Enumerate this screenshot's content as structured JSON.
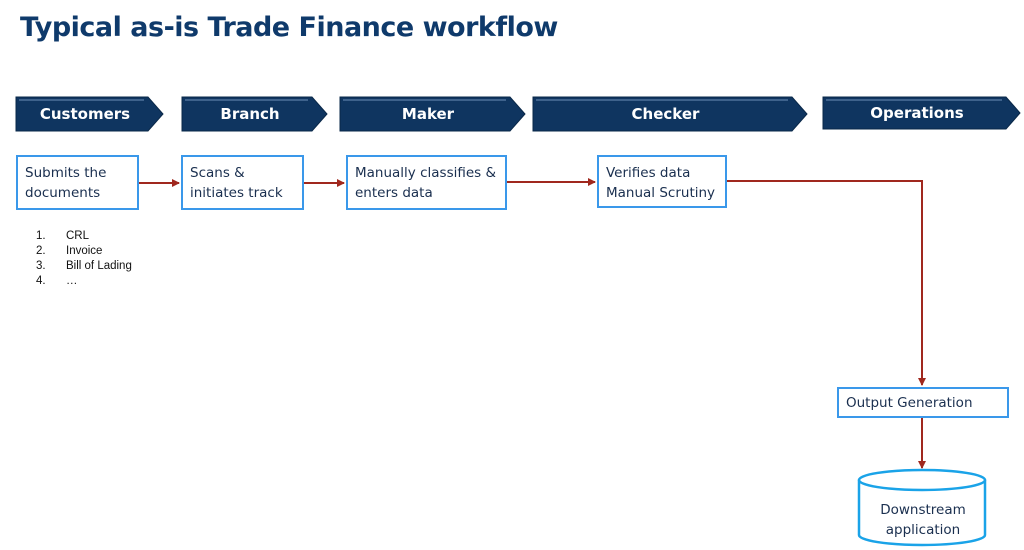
{
  "title": "Typical as-is Trade Finance workflow",
  "lanes": [
    {
      "label": "Customers"
    },
    {
      "label": "Branch"
    },
    {
      "label": "Maker"
    },
    {
      "label": "Checker"
    },
    {
      "label": "Operations"
    }
  ],
  "steps": {
    "customers": {
      "line1": "Submits the",
      "line2": "documents"
    },
    "branch": {
      "line1": "Scans &",
      "line2": "initiates track"
    },
    "maker": {
      "line1": "Manually classifies &",
      "line2": "enters data"
    },
    "checker": {
      "line1": "Verifies data",
      "line2": "Manual Scrutiny"
    },
    "operations": {
      "line1": "Output Generation"
    }
  },
  "documents": [
    {
      "num": "1.",
      "label": "CRL"
    },
    {
      "num": "2.",
      "label": "Invoice"
    },
    {
      "num": "3.",
      "label": "Bill of Lading"
    },
    {
      "num": "4.",
      "label": "…"
    }
  ],
  "downstream": {
    "line1": "Downstream",
    "line2": "application"
  },
  "colors": {
    "lane_fill": "#0f3560",
    "box_border": "#3a98ea",
    "arrow": "#a0281e",
    "cylinder": "#1aa3e8",
    "title": "#0f3a6b"
  }
}
